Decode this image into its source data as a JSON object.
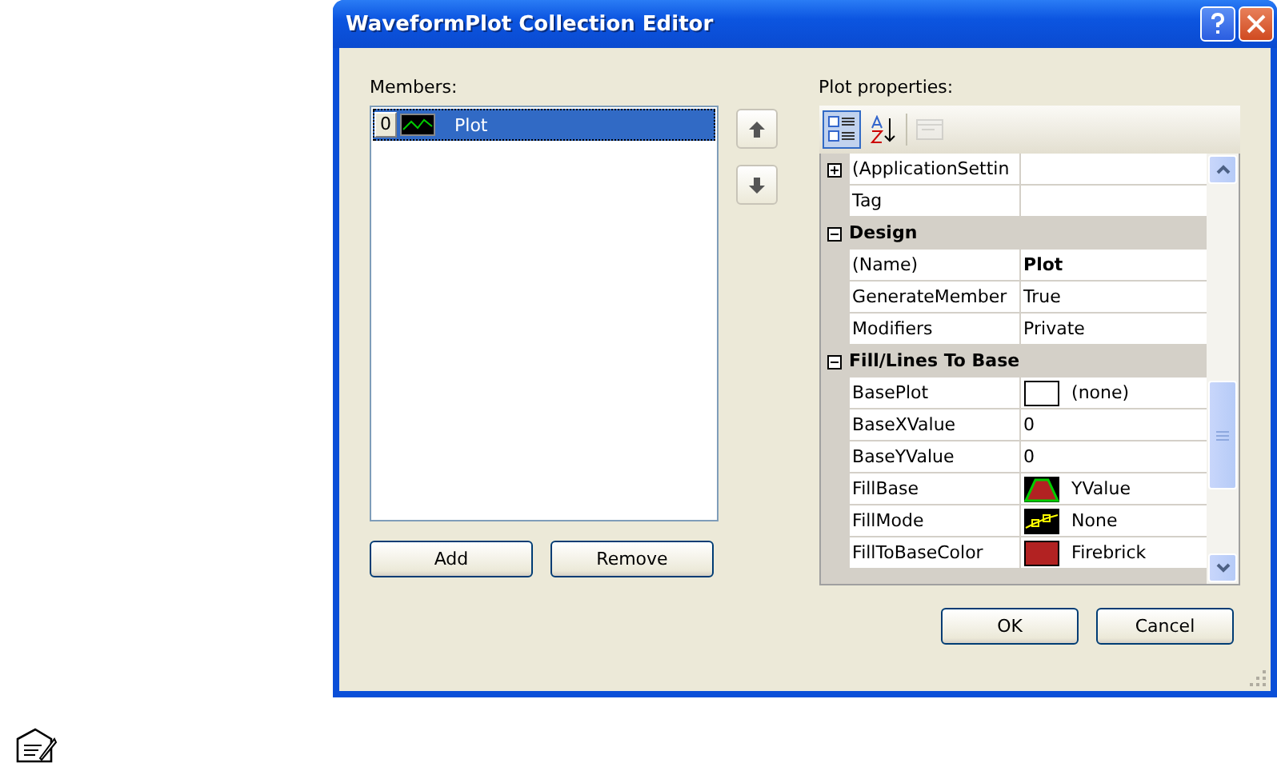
{
  "window": {
    "title": "WaveformPlot Collection Editor"
  },
  "members": {
    "label": "Members:",
    "items": [
      {
        "index": "0",
        "name": "Plot",
        "selected": true
      }
    ]
  },
  "member_buttons": [
    "Add",
    "Remove"
  ],
  "properties": {
    "label": "Plot properties:",
    "toolbar": [
      {
        "kind": "categorized",
        "selected": true,
        "disabled": false
      },
      {
        "kind": "alphabetical",
        "selected": false,
        "disabled": false
      },
      {
        "kind": "pages",
        "selected": false,
        "disabled": true
      }
    ],
    "rows": [
      {
        "kind": "property",
        "name": "(ApplicationSettin",
        "value": "",
        "expandable": true,
        "expanded": false
      },
      {
        "kind": "property",
        "name": "Tag",
        "value": ""
      },
      {
        "kind": "category",
        "name": "Design",
        "expanded": true
      },
      {
        "kind": "property",
        "name": "(Name)",
        "value": "Plot",
        "bold": true
      },
      {
        "kind": "property",
        "name": "GenerateMember",
        "value": "True"
      },
      {
        "kind": "property",
        "name": "Modifiers",
        "value": "Private"
      },
      {
        "kind": "category",
        "name": "Fill/Lines To Base",
        "expanded": true
      },
      {
        "kind": "property",
        "name": "BasePlot",
        "value": "(none)",
        "swatch": {
          "kind": "empty"
        }
      },
      {
        "kind": "property",
        "name": "BaseXValue",
        "value": "0"
      },
      {
        "kind": "property",
        "name": "BaseYValue",
        "value": "0"
      },
      {
        "kind": "property",
        "name": "FillBase",
        "value": "YValue",
        "swatch": {
          "kind": "fill-base"
        }
      },
      {
        "kind": "property",
        "name": "FillMode",
        "value": "None",
        "swatch": {
          "kind": "fill-mode"
        }
      },
      {
        "kind": "property",
        "name": "FillToBaseColor",
        "value": "Firebrick",
        "swatch": {
          "kind": "color",
          "color": "#b22222"
        }
      }
    ]
  },
  "dialog_buttons": [
    "OK",
    "Cancel"
  ]
}
